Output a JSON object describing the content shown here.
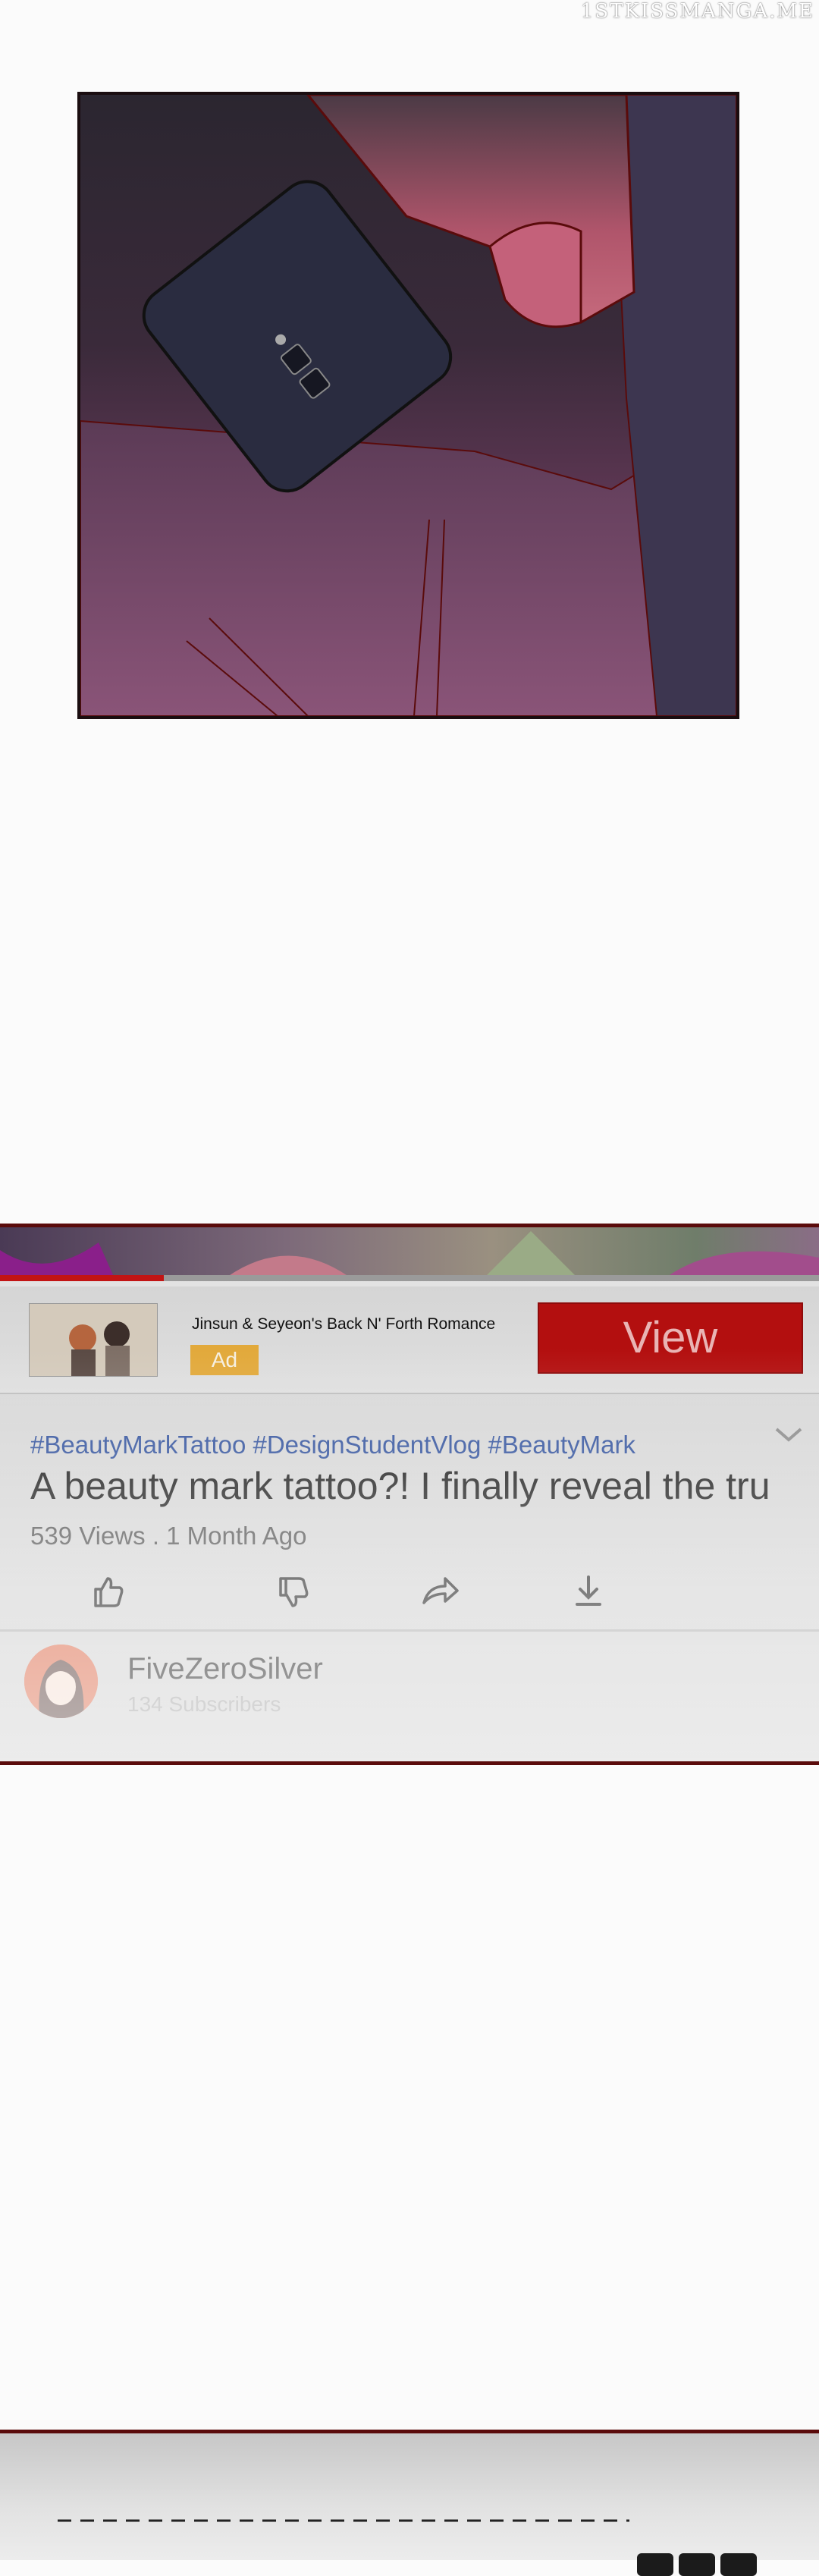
{
  "watermark": "1STKISSMANGA.ME",
  "video": {
    "progress_fraction": 0.2,
    "ad": {
      "title": "Jinsun & Seyeon's Back N' Forth Romance",
      "badge": "Ad",
      "button_label": "View"
    },
    "hashtags": "#BeautyMarkTattoo #DesignStudentVlog #BeautyMark",
    "title": "A beauty mark tattoo?! I finally reveal the tru",
    "meta": "539 Views . 1 Month Ago",
    "actions": [
      "like-icon",
      "dislike-icon",
      "share-icon",
      "download-icon"
    ],
    "channel": {
      "name": "FiveZeroSilver",
      "subscribers": "134 Subscribers"
    }
  },
  "colors": {
    "accent_red": "#b30f0f",
    "ad_badge": "#e2a93b",
    "hashtag_blue": "#2c4d9a",
    "panel_border": "#5a0b0b"
  }
}
